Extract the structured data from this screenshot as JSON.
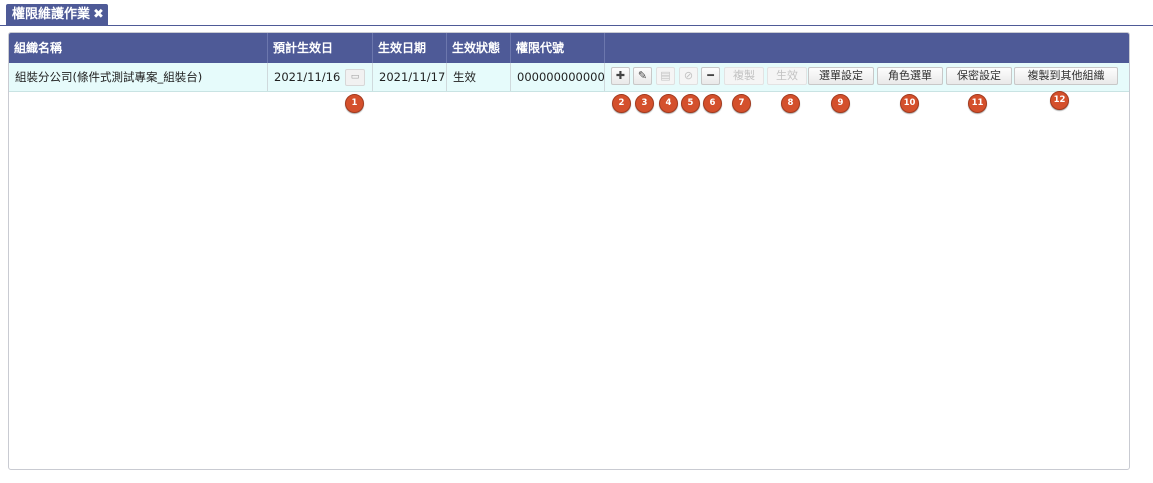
{
  "tab": {
    "title": "權限維護作業",
    "close_glyph": "✖"
  },
  "table": {
    "columns": [
      "組織名稱",
      "預計生效日",
      "生效日期",
      "生效狀態",
      "權限代號"
    ],
    "row": {
      "org_name": "組裝分公司(條件式測試專案_組裝台)",
      "planned_date": "2021/11/16",
      "effective_date": "2021/11/17",
      "status": "生效",
      "perm_code": "000000000000"
    }
  },
  "toolbar": {
    "add_glyph": "✚",
    "edit_glyph": "✎",
    "save_glyph": "▤",
    "cancel_glyph": "⊘",
    "delete_glyph": "━",
    "copy_label": "複製",
    "activate_label": "生效",
    "menu_setting_label": "選單設定",
    "role_menu_label": "角色選單",
    "secrecy_setting_label": "保密設定",
    "copy_to_org_label": "複製到其他組織"
  },
  "icons": {
    "picker": "folder-open-icon"
  },
  "markers": [
    "1",
    "2",
    "3",
    "4",
    "5",
    "6",
    "7",
    "8",
    "9",
    "10",
    "11",
    "12"
  ],
  "colors": {
    "header": "#4e5a97",
    "row_bg": "#e6fbfb",
    "marker": "#d4502c"
  }
}
